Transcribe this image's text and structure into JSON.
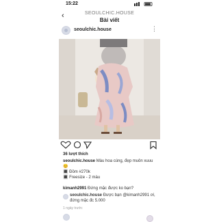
{
  "status_bar": {
    "time": "15:22"
  },
  "nav": {
    "subtitle": "SEOULCHIC.HOUSE",
    "title": "Bài viết"
  },
  "post": {
    "username": "seoulchic.house",
    "likes": "36 lượt thích",
    "caption_user": "seoulchic.house",
    "caption_text": "Màu hoa cúng, đẹp muôn xuuu 😊",
    "caption_lines": [
      "🔳 Đồm #270k",
      "🔳 Freesize - 2 màu"
    ],
    "comments": [
      {
        "user": "kimanh2991",
        "text": "Đứng mặc được ko bạn?"
      }
    ],
    "reply": {
      "user": "seoulchic.house",
      "text": "Được bạn @kimanh2991 ơi, đứng mặc đc 5.000"
    },
    "timestamp": "1 ngày trước"
  },
  "colors": {
    "accent": "#262626",
    "muted": "#8e8e8e",
    "dress_pink": "#e8c9c6",
    "dress_blue": "#7c8cc3"
  },
  "icons": [
    "back-chevron-icon",
    "more-icon",
    "heart-icon",
    "comment-icon",
    "share-icon",
    "bookmark-icon"
  ]
}
